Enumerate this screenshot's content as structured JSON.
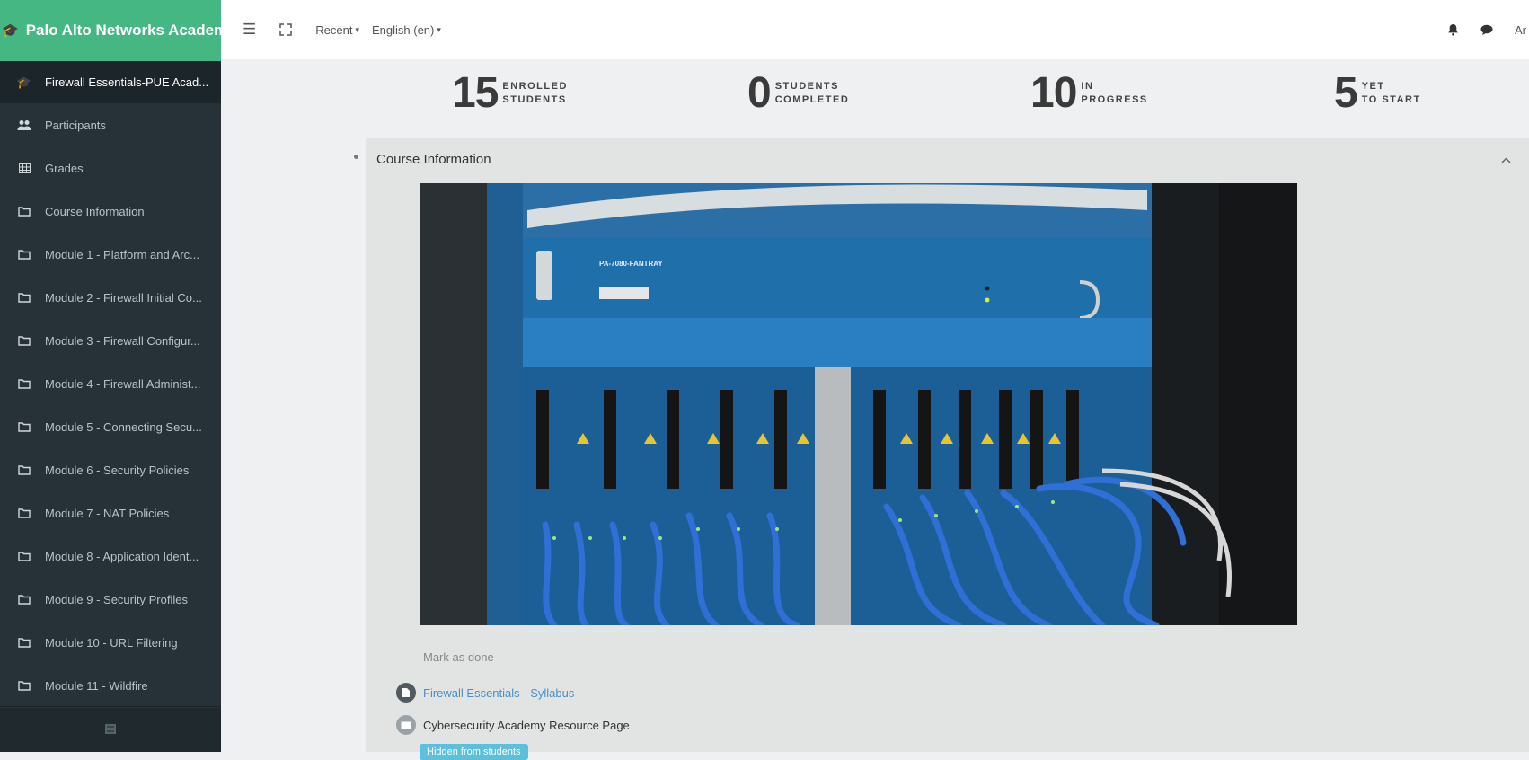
{
  "brand": {
    "title": "Palo Alto Networks Academy"
  },
  "topbar": {
    "menu_icon": "hamburger-icon",
    "fullscreen_icon": "fullscreen-icon",
    "recent": "Recent",
    "language": "English (en)",
    "user_partial": "Ar"
  },
  "sidebar": {
    "items": [
      {
        "label": "Firewall Essentials-PUE Acad...",
        "icon": "graduation-cap-icon"
      },
      {
        "label": "Participants",
        "icon": "users-icon"
      },
      {
        "label": "Grades",
        "icon": "table-icon"
      },
      {
        "label": "Course Information",
        "icon": "folder-icon"
      },
      {
        "label": "Module 1 - Platform and Arc...",
        "icon": "folder-icon"
      },
      {
        "label": "Module 2 - Firewall Initial Co...",
        "icon": "folder-icon"
      },
      {
        "label": "Module 3 - Firewall Configur...",
        "icon": "folder-icon"
      },
      {
        "label": "Module 4 - Firewall Administ...",
        "icon": "folder-icon"
      },
      {
        "label": "Module 5 - Connecting Secu...",
        "icon": "folder-icon"
      },
      {
        "label": "Module 6 - Security Policies",
        "icon": "folder-icon"
      },
      {
        "label": "Module 7 - NAT Policies",
        "icon": "folder-icon"
      },
      {
        "label": "Module 8 - Application Ident...",
        "icon": "folder-icon"
      },
      {
        "label": "Module 9 - Security Profiles",
        "icon": "folder-icon"
      },
      {
        "label": "Module 10 - URL Filtering",
        "icon": "folder-icon"
      },
      {
        "label": "Module 11 - Wildfire",
        "icon": "folder-icon"
      }
    ]
  },
  "stats": [
    {
      "value": "15",
      "line1": "ENROLLED",
      "line2": "STUDENTS"
    },
    {
      "value": "0",
      "line1": "STUDENTS",
      "line2": "COMPLETED"
    },
    {
      "value": "10",
      "line1": "IN",
      "line2": "PROGRESS"
    },
    {
      "value": "5",
      "line1": "YET",
      "line2": "TO START"
    }
  ],
  "section": {
    "title": "Course Information",
    "collapse_icon": "chevron-up-icon",
    "image_fantray_label": "PA-7080-FANTRAY",
    "mark_done": "Mark as done",
    "syllabus_link": "Firewall Essentials - Syllabus",
    "resource_page": "Cybersecurity Academy Resource Page",
    "hidden_badge": "Hidden from students"
  },
  "colors": {
    "brand": "#44b783",
    "sidebar": "#263238",
    "link": "#4a8fc8",
    "badge": "#5bc0de"
  }
}
